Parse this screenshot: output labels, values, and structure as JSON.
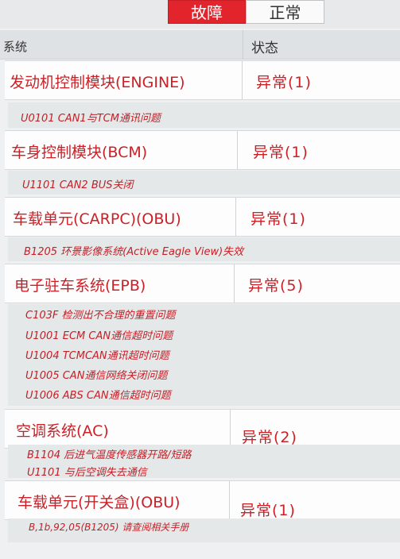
{
  "tabs": {
    "fault": "故障",
    "normal": "正常"
  },
  "header": {
    "system": "系统",
    "status": "状态"
  },
  "modules": [
    {
      "name": "发动机控制模块(ENGINE)",
      "status": "异常(1)",
      "dtcs": [
        "U0101 CAN1与TCM通讯问题"
      ]
    },
    {
      "name": "车身控制模块(BCM)",
      "status": "异常(1)",
      "dtcs": [
        "U1101 CAN2 BUS关闭"
      ]
    },
    {
      "name": "车载单元(CARPC)(OBU)",
      "status": "异常(1)",
      "dtcs": [
        "B1205 环景影像系统(Active Eagle View)失效"
      ]
    },
    {
      "name": "电子驻车系统(EPB)",
      "status": "异常(5)",
      "dtcs": [
        "C103F 检测出不合理的重置问题",
        "U1001 ECM CAN通信超时问题",
        "U1004 TCMCAN通讯超时问题",
        "U1005 CAN通信网络关闭问题",
        "U1006 ABS CAN通信超时问题"
      ]
    },
    {
      "name": "空调系统(AC)",
      "status": "异常(2)",
      "dtcs": [
        "B1104 后进气温度传感器开路/短路",
        "U1101 与后空调失去通信"
      ]
    },
    {
      "name": "车载单元(开关盒)(OBU)",
      "status": "异常(1)",
      "dtcs": [
        "B,1b,92,05(B1205) 请查阅相关手册"
      ]
    }
  ],
  "colors": {
    "accent": "#e2252c",
    "fault_text": "#cc1f26"
  }
}
